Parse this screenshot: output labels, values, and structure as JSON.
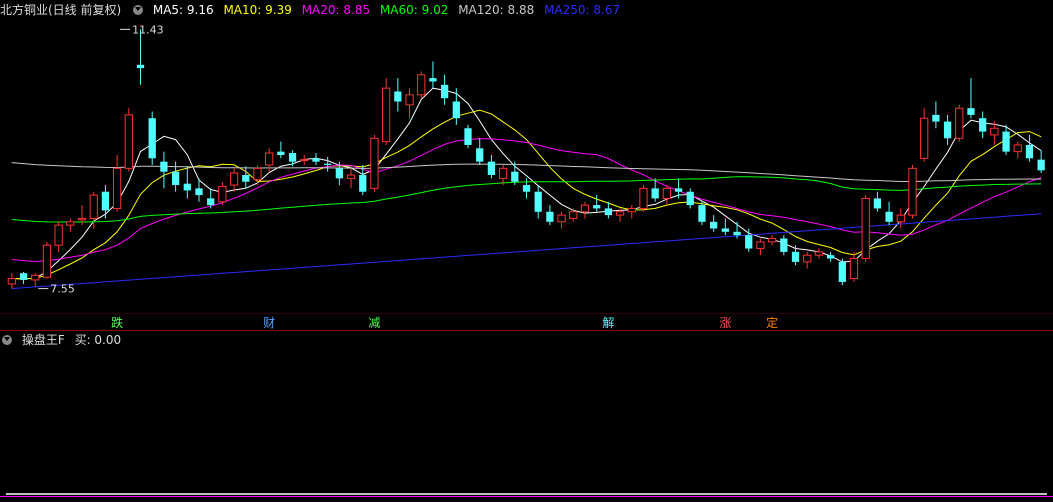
{
  "header": {
    "title": "北方铜业(日线 前复权)",
    "ma_labels": [
      {
        "text": "MA5: 9.16",
        "color": "#ffffff"
      },
      {
        "text": "MA10: 9.39",
        "color": "#ffff00"
      },
      {
        "text": "MA20: 8.85",
        "color": "#ff00ff"
      },
      {
        "text": "MA60: 9.02",
        "color": "#00ff00"
      },
      {
        "text": "MA120: 8.88",
        "color": "#c8c8c8"
      },
      {
        "text": "MA250: 8.67",
        "color": "#2b2bff"
      }
    ]
  },
  "indicator": {
    "title": "操盘王F",
    "value_label": "买: 0.00"
  },
  "colors": {
    "up": "#ff3232",
    "down": "#54ffff"
  },
  "chart_data": [
    {
      "type": "candlestick",
      "y_range": [
        7.2,
        11.6
      ],
      "annotations": [
        {
          "text": "11.43",
          "candle_index": 9
        },
        {
          "text": "7.55",
          "candle_index": 2
        }
      ],
      "signals": [
        {
          "text": "跌",
          "candle_index": 9,
          "color": "#55ff55"
        },
        {
          "text": "财",
          "candle_index": 22,
          "color": "#5aa0ff"
        },
        {
          "text": "减",
          "candle_index": 31,
          "color": "#55ff55"
        },
        {
          "text": "解",
          "candle_index": 51,
          "color": "#54ffff"
        },
        {
          "text": "涨",
          "candle_index": 61,
          "color": "#ff5050"
        },
        {
          "text": "定",
          "candle_index": 65,
          "color": "#ff8000"
        }
      ],
      "candles": [
        [
          7.62,
          7.78,
          7.55,
          7.7
        ],
        [
          7.78,
          7.8,
          7.62,
          7.68
        ],
        [
          7.68,
          7.78,
          7.58,
          7.75
        ],
        [
          7.72,
          8.25,
          7.7,
          8.2
        ],
        [
          8.2,
          8.55,
          8.1,
          8.5
        ],
        [
          8.5,
          8.6,
          8.4,
          8.55
        ],
        [
          8.58,
          8.8,
          8.5,
          8.6
        ],
        [
          8.6,
          9.0,
          8.45,
          8.95
        ],
        [
          9.0,
          9.1,
          8.6,
          8.72
        ],
        [
          8.75,
          9.55,
          8.7,
          9.35
        ],
        [
          9.35,
          10.25,
          9.3,
          10.15
        ],
        [
          10.9,
          11.43,
          10.6,
          10.85
        ],
        [
          10.1,
          10.2,
          9.4,
          9.5
        ],
        [
          9.45,
          9.6,
          9.05,
          9.3
        ],
        [
          9.3,
          9.45,
          9.0,
          9.1
        ],
        [
          9.12,
          9.38,
          8.9,
          9.02
        ],
        [
          9.05,
          9.2,
          8.85,
          8.95
        ],
        [
          8.9,
          9.05,
          8.75,
          8.8
        ],
        [
          8.85,
          9.15,
          8.8,
          9.08
        ],
        [
          9.1,
          9.35,
          9.0,
          9.28
        ],
        [
          9.25,
          9.38,
          9.05,
          9.15
        ],
        [
          9.18,
          9.4,
          9.1,
          9.35
        ],
        [
          9.4,
          9.65,
          9.3,
          9.58
        ],
        [
          9.6,
          9.75,
          9.5,
          9.55
        ],
        [
          9.58,
          9.62,
          9.38,
          9.45
        ],
        [
          9.48,
          9.55,
          9.4,
          9.48
        ],
        [
          9.5,
          9.58,
          9.4,
          9.45
        ],
        [
          9.42,
          9.52,
          9.3,
          9.4
        ],
        [
          9.35,
          9.45,
          9.1,
          9.2
        ],
        [
          9.2,
          9.35,
          9.05,
          9.25
        ],
        [
          9.25,
          9.4,
          8.95,
          9.0
        ],
        [
          9.05,
          9.85,
          9.0,
          9.8
        ],
        [
          9.75,
          10.7,
          9.7,
          10.55
        ],
        [
          10.5,
          10.7,
          10.2,
          10.35
        ],
        [
          10.3,
          10.55,
          10.1,
          10.45
        ],
        [
          10.45,
          10.8,
          10.4,
          10.75
        ],
        [
          10.7,
          10.95,
          10.55,
          10.65
        ],
        [
          10.6,
          10.75,
          10.3,
          10.4
        ],
        [
          10.35,
          10.55,
          10.0,
          10.1
        ],
        [
          9.95,
          10.0,
          9.65,
          9.7
        ],
        [
          9.65,
          9.8,
          9.4,
          9.45
        ],
        [
          9.45,
          9.55,
          9.2,
          9.25
        ],
        [
          9.2,
          9.4,
          9.1,
          9.35
        ],
        [
          9.3,
          9.45,
          9.1,
          9.15
        ],
        [
          9.1,
          9.2,
          8.9,
          9.0
        ],
        [
          9.0,
          9.1,
          8.6,
          8.7
        ],
        [
          8.7,
          8.8,
          8.5,
          8.55
        ],
        [
          8.55,
          8.7,
          8.45,
          8.65
        ],
        [
          8.6,
          8.75,
          8.55,
          8.7
        ],
        [
          8.7,
          8.85,
          8.6,
          8.8
        ],
        [
          8.8,
          8.95,
          8.7,
          8.75
        ],
        [
          8.75,
          8.85,
          8.6,
          8.65
        ],
        [
          8.65,
          8.75,
          8.55,
          8.7
        ],
        [
          8.7,
          8.8,
          8.6,
          8.75
        ],
        [
          8.75,
          9.1,
          8.7,
          9.05
        ],
        [
          9.05,
          9.2,
          8.85,
          8.9
        ],
        [
          8.9,
          9.1,
          8.8,
          9.05
        ],
        [
          9.05,
          9.2,
          8.9,
          9.0
        ],
        [
          9.0,
          9.05,
          8.75,
          8.8
        ],
        [
          8.8,
          8.85,
          8.5,
          8.55
        ],
        [
          8.55,
          8.65,
          8.4,
          8.45
        ],
        [
          8.45,
          8.6,
          8.35,
          8.4
        ],
        [
          8.4,
          8.55,
          8.3,
          8.35
        ],
        [
          8.35,
          8.45,
          8.1,
          8.15
        ],
        [
          8.15,
          8.3,
          8.05,
          8.25
        ],
        [
          8.25,
          8.35,
          8.2,
          8.3
        ],
        [
          8.3,
          8.35,
          8.05,
          8.1
        ],
        [
          8.1,
          8.2,
          7.9,
          7.95
        ],
        [
          7.95,
          8.1,
          7.85,
          8.05
        ],
        [
          8.05,
          8.15,
          8.0,
          8.1
        ],
        [
          8.05,
          8.1,
          7.95,
          8.0
        ],
        [
          7.95,
          8.0,
          7.6,
          7.65
        ],
        [
          7.7,
          8.1,
          7.65,
          8.0
        ],
        [
          8.0,
          8.95,
          7.95,
          8.9
        ],
        [
          8.9,
          9.0,
          8.7,
          8.75
        ],
        [
          8.7,
          8.85,
          8.5,
          8.55
        ],
        [
          8.55,
          8.75,
          8.45,
          8.65
        ],
        [
          8.65,
          9.4,
          8.6,
          9.35
        ],
        [
          9.5,
          10.25,
          9.45,
          10.1
        ],
        [
          10.15,
          10.35,
          9.95,
          10.05
        ],
        [
          10.05,
          10.15,
          9.7,
          9.8
        ],
        [
          9.8,
          10.3,
          9.75,
          10.25
        ],
        [
          10.25,
          10.7,
          10.1,
          10.15
        ],
        [
          10.1,
          10.2,
          9.8,
          9.9
        ],
        [
          9.85,
          10.05,
          9.7,
          9.95
        ],
        [
          9.9,
          10.0,
          9.55,
          9.6
        ],
        [
          9.6,
          9.75,
          9.5,
          9.7
        ],
        [
          9.7,
          9.85,
          9.45,
          9.5
        ],
        [
          9.48,
          9.62,
          9.28,
          9.32
        ]
      ]
    },
    {
      "type": "line",
      "y_range": [
        0,
        1
      ],
      "values": [
        0,
        0,
        0,
        0,
        0,
        0,
        0,
        0,
        0,
        0,
        0,
        0,
        0,
        0,
        0,
        0,
        0,
        0,
        0,
        0,
        0,
        0,
        0,
        0,
        0,
        0,
        0,
        0,
        0,
        0,
        0,
        0,
        0,
        0,
        0,
        0,
        0,
        0,
        0,
        0,
        0,
        0,
        0,
        0,
        0,
        0,
        0,
        0,
        0,
        0,
        0,
        0,
        0,
        0,
        0,
        0,
        0,
        0,
        0,
        0,
        0,
        0,
        0,
        0,
        0,
        0,
        0,
        0,
        0,
        0,
        0,
        0,
        0,
        0,
        0,
        0,
        0,
        0,
        0,
        0,
        0,
        0,
        0,
        0,
        0,
        0,
        0,
        0,
        0,
        0,
        0,
        0,
        0,
        0,
        0,
        0,
        0,
        0,
        0,
        0,
        0,
        0,
        0,
        0,
        0,
        0,
        0,
        0,
        0,
        0,
        0,
        0,
        0,
        0,
        0,
        0,
        0,
        0,
        0,
        0,
        0,
        0,
        0,
        0,
        0,
        0,
        0,
        0,
        0,
        0,
        0,
        0,
        0,
        0,
        0,
        0,
        0,
        0,
        0,
        0,
        0,
        0,
        0,
        0,
        0,
        0,
        0,
        0,
        0,
        0,
        0,
        0,
        0,
        0,
        0,
        0,
        0,
        0,
        0,
        0
      ]
    }
  ]
}
